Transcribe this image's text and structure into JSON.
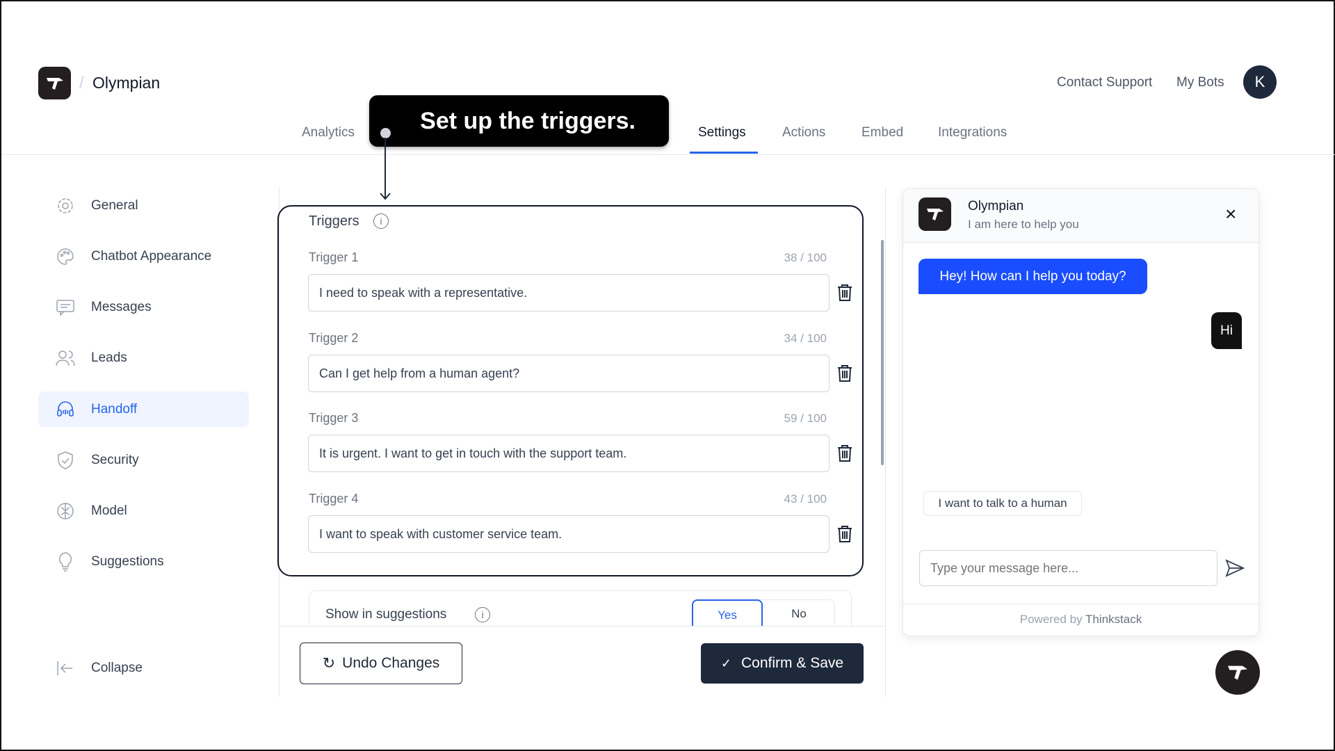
{
  "header": {
    "brand": "Olympian",
    "separator": "/",
    "contact_support": "Contact Support",
    "my_bots": "My Bots",
    "avatar_initial": "K"
  },
  "tabs": [
    {
      "label": "Analytics"
    },
    {
      "label": "Settings",
      "active": true
    },
    {
      "label": "Actions"
    },
    {
      "label": "Embed"
    },
    {
      "label": "Integrations"
    }
  ],
  "tooltip": {
    "text": "Set up the triggers."
  },
  "sidebar": {
    "items": [
      {
        "label": "General",
        "icon": "gear-icon"
      },
      {
        "label": "Chatbot Appearance",
        "icon": "palette-icon"
      },
      {
        "label": "Messages",
        "icon": "message-icon"
      },
      {
        "label": "Leads",
        "icon": "users-icon"
      },
      {
        "label": "Handoff",
        "icon": "headset-icon",
        "active": true
      },
      {
        "label": "Security",
        "icon": "shield-icon"
      },
      {
        "label": "Model",
        "icon": "brain-icon"
      },
      {
        "label": "Suggestions",
        "icon": "lightbulb-icon"
      }
    ],
    "collapse": "Collapse"
  },
  "triggers": {
    "title": "Triggers",
    "items": [
      {
        "label": "Trigger 1",
        "count": "38 / 100",
        "value": "I need to speak with a representative."
      },
      {
        "label": "Trigger 2",
        "count": "34 / 100",
        "value": "Can I get help from a human agent?"
      },
      {
        "label": "Trigger 3",
        "count": "59 / 100",
        "value": "It is urgent. I want to get in touch with the support team."
      },
      {
        "label": "Trigger 4",
        "count": "43 / 100",
        "value": "I want to speak with customer service team."
      }
    ]
  },
  "suggestions": {
    "label": "Show in suggestions",
    "yes": "Yes",
    "no": "No",
    "selected": "Yes"
  },
  "footer": {
    "undo": "Undo Changes",
    "confirm": "Confirm & Save"
  },
  "chat": {
    "name": "Olympian",
    "subtitle": "I am here to help you",
    "bot_message": "Hey! How can I help you today?",
    "user_message": "Hi",
    "suggestion": "I want to talk to a human",
    "placeholder": "Type your message here...",
    "powered_prefix": "Powered by",
    "powered_brand": "Thinkstack"
  },
  "colors": {
    "accent": "#2563eb",
    "bubble": "#1a4dff",
    "dark": "#1e293b"
  }
}
